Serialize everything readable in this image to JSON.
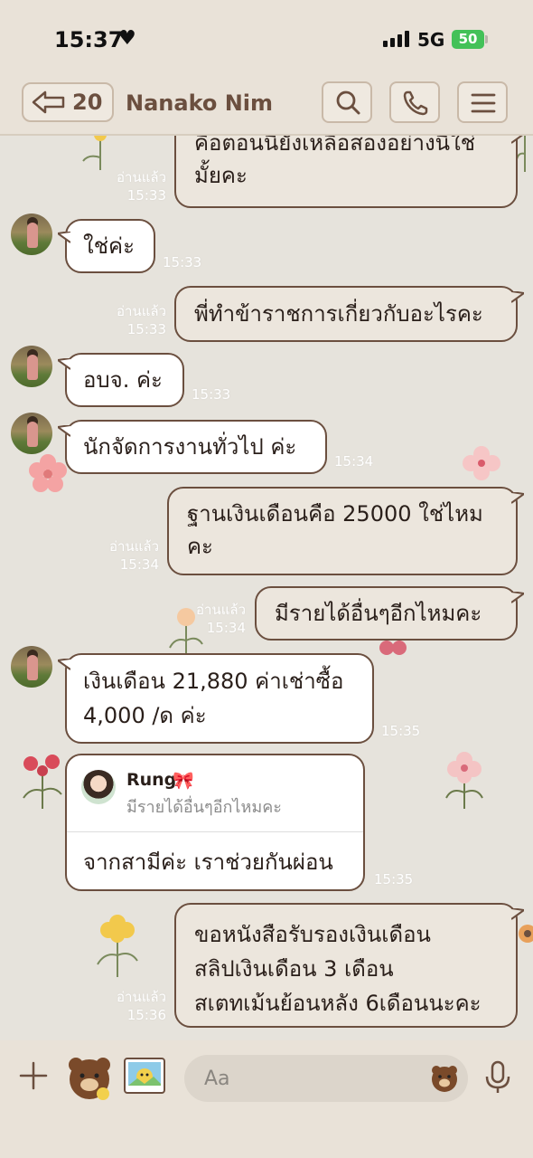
{
  "status_bar": {
    "time": "15:37",
    "network": "5G",
    "battery": "50"
  },
  "header": {
    "back_count": "20",
    "title": "Nanako Nim"
  },
  "messages": [
    {
      "id": "m1",
      "text": "คือตอนนี้ยังเหลือสองอย่างนี้ใช่มั้ยคะ",
      "read": "อ่านแล้ว",
      "time": "15:33"
    },
    {
      "id": "m2",
      "text": "ใช่ค่ะ",
      "time": "15:33"
    },
    {
      "id": "m3",
      "text": "พี่ทำข้าราชการเกี่ยวกับอะไรคะ",
      "read": "อ่านแล้ว",
      "time": "15:33"
    },
    {
      "id": "m4",
      "text": "อบจ. ค่ะ",
      "time": "15:33"
    },
    {
      "id": "m5",
      "text": "นักจัดการงานทั่วไป ค่ะ",
      "time": "15:34"
    },
    {
      "id": "m6",
      "text": "ฐานเงินเดือนคือ 25000 ใช่ไหมคะ",
      "read": "อ่านแล้ว",
      "time": "15:34"
    },
    {
      "id": "m7",
      "text": "มีรายได้อื่นๆอีกไหมคะ",
      "read": "อ่านแล้ว",
      "time": "15:34"
    },
    {
      "id": "m8",
      "text": "เงินเดือน 21,880 ค่าเช่าซื้อ 4,000 /ด ค่ะ",
      "time": "15:35"
    },
    {
      "id": "m9",
      "quote_name": "Rung",
      "quote_text": "มีรายได้อื่นๆอีกไหมคะ",
      "text": "จากสามีค่ะ เราช่วยกันผ่อน",
      "time": "15:35"
    },
    {
      "id": "m10",
      "lines": [
        "ขอหนังสือรับรองเงินเดือน",
        "สลิปเงินเดือน 3 เดือน",
        "สเตทเม้นย้อนหลัง 6เดือนนะคะ"
      ],
      "read": "อ่านแล้ว",
      "time": "15:36"
    }
  ],
  "input": {
    "placeholder": "Aa"
  },
  "icons": [
    "back-arrow-icon",
    "search-icon",
    "phone-icon",
    "menu-icon",
    "plus-icon",
    "sticker-icon",
    "photo-icon",
    "emoji-icon",
    "mic-icon"
  ],
  "colors": {
    "bubble_border": "#6b4f3f",
    "my_bubble": "#ece6dd",
    "header_bg": "#e9e2d8",
    "chat_bg": "#e6e3dc",
    "battery": "#43c158"
  }
}
